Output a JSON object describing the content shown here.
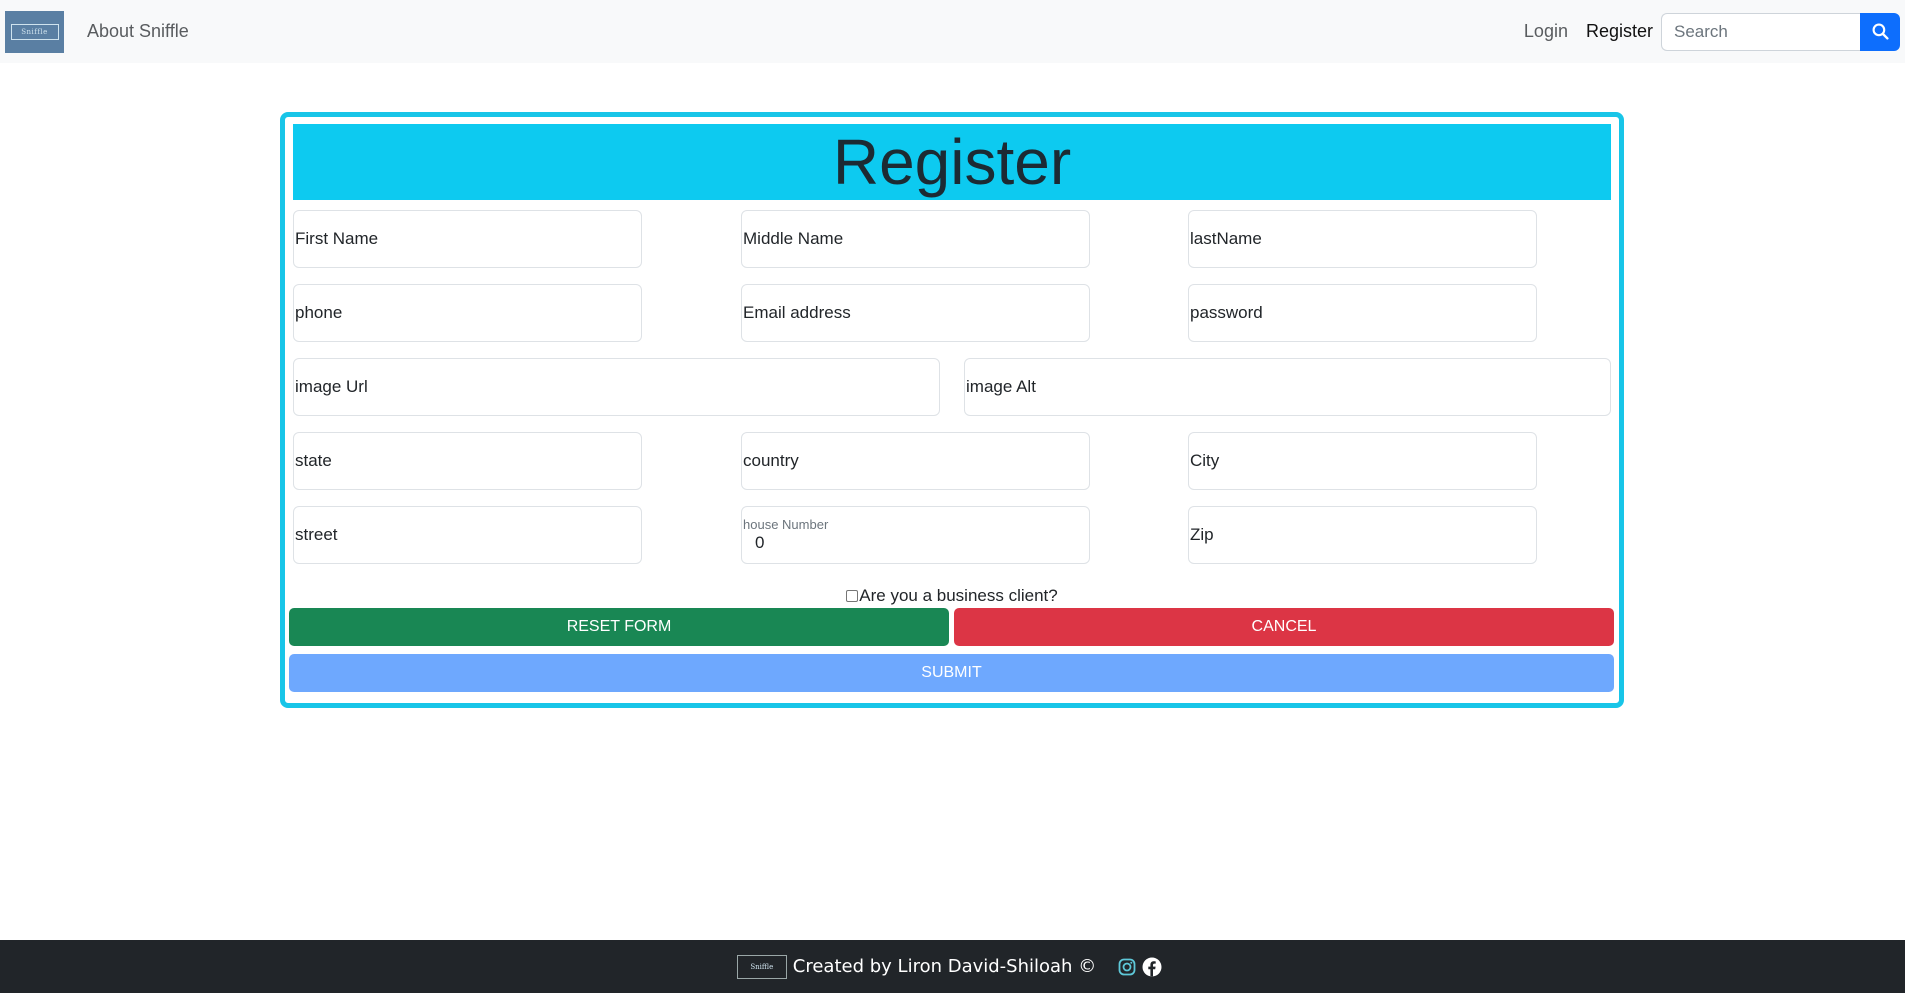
{
  "navbar": {
    "logo_text": "Sniffle",
    "about_label": "About Sniffle",
    "login_label": "Login",
    "register_label": "Register",
    "search_placeholder": "Search",
    "search_icon": "search-icon"
  },
  "form": {
    "title": "Register",
    "fields": {
      "first_name": "First Name",
      "middle_name": "Middle Name",
      "last_name": "lastName",
      "phone": "phone",
      "email": "Email address",
      "password": "password",
      "image_url": "image Url",
      "image_alt": "image Alt",
      "state": "state",
      "country": "country",
      "city": "City",
      "street": "street",
      "house_number_label": "house Number",
      "house_number_value": "0",
      "zip": "Zip"
    },
    "business_checkbox_label": "Are you a business client?",
    "business_checked": false,
    "reset_label": "RESET FORM",
    "cancel_label": "CANCEL",
    "submit_label": "SUBMIT"
  },
  "footer": {
    "logo_text": "Sniffle",
    "credit": "Created by Liron David-Shiloah ©",
    "icons": [
      "instagram-icon",
      "facebook-icon"
    ]
  },
  "colors": {
    "title_bg": "#0dcaf0",
    "card_border": "#18c5e8",
    "reset": "#198754",
    "cancel": "#dc3545",
    "submit": "#6ea8fe",
    "search_button": "#0d6efd",
    "footer_bg": "#212529"
  }
}
